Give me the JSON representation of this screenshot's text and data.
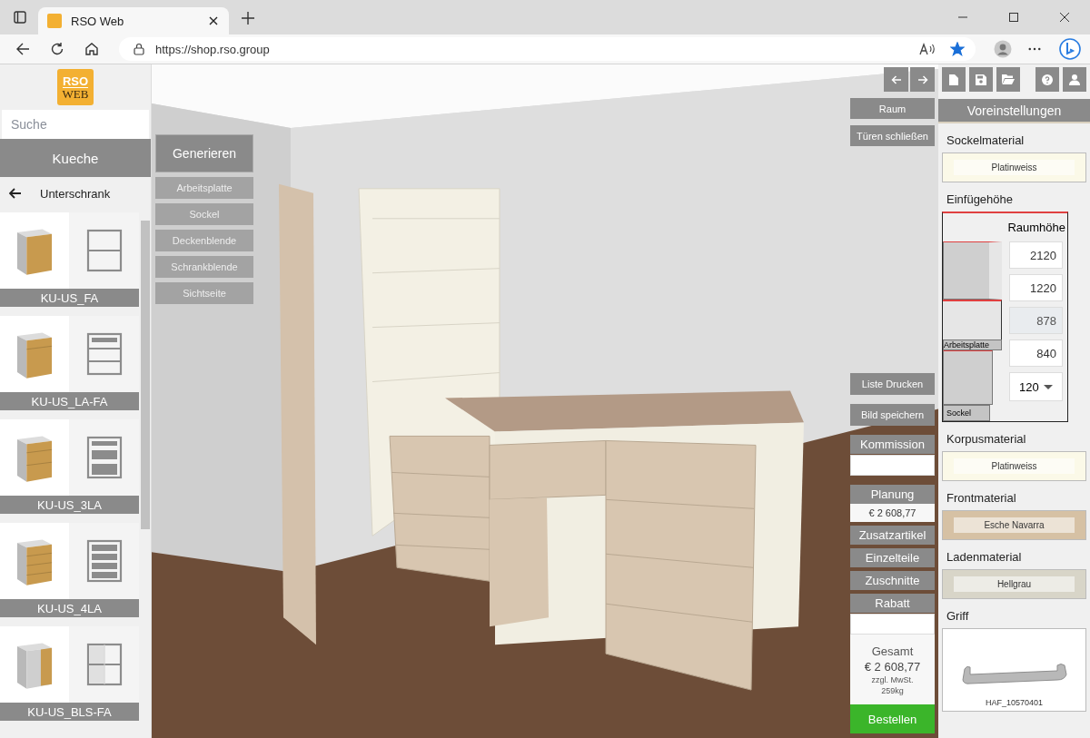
{
  "browser": {
    "tab_title": "RSO Web",
    "url": "https://shop.rso.group",
    "favorite": true
  },
  "sidebar": {
    "logo": {
      "top": "RSO",
      "bottom": "WEB"
    },
    "search": {
      "placeholder": "Suche"
    },
    "category": "Kueche",
    "breadcrumb": "Unterschrank",
    "items": [
      {
        "label": "KU-US_FA",
        "kind": "door"
      },
      {
        "label": "KU-US_LA-FA",
        "kind": "drawer-door"
      },
      {
        "label": "KU-US_3LA",
        "kind": "drawers-3"
      },
      {
        "label": "KU-US_4LA",
        "kind": "drawers-4"
      },
      {
        "label": "KU-US_BLS-FA",
        "kind": "corner"
      }
    ]
  },
  "scene": {
    "generate": {
      "title": "Generieren",
      "options": [
        "Arbeitsplatte",
        "Sockel",
        "Deckenblende",
        "Schrankblende",
        "Sichtseite"
      ]
    },
    "view_buttons": [
      "Raum",
      "Türen schließen"
    ],
    "action_buttons": [
      "Liste Drucken",
      "Bild speichern"
    ],
    "commission": {
      "label": "Kommission"
    },
    "planning": {
      "label": "Planung",
      "value": "€ 2 608,77"
    },
    "menu_buttons": [
      "Zusatzartikel",
      "Einzelteile",
      "Zuschnitte"
    ],
    "discount": {
      "label": "Rabatt"
    },
    "total": {
      "label": "Gesamt",
      "value": "€ 2 608,77",
      "note": "zzgl. MwSt.",
      "weight": "259kg"
    },
    "order_button": "Bestellen"
  },
  "presets": {
    "title": "Voreinstellungen",
    "base_material": {
      "label": "Sockelmaterial",
      "value": "Platinweiss",
      "color": "#fbf9e8"
    },
    "insert_height": {
      "label": "Einfügehöhe",
      "room_height_label": "Raumhöhe",
      "worktop_label": "Arbeitsplatte",
      "base_label": "Sockel",
      "fields": [
        {
          "value": "2120",
          "kind": "input",
          "disabled": false
        },
        {
          "value": "1220",
          "kind": "input",
          "disabled": false
        },
        {
          "value": "878",
          "kind": "input",
          "disabled": true
        },
        {
          "value": "840",
          "kind": "input",
          "disabled": false
        },
        {
          "value": "120",
          "kind": "select",
          "disabled": false
        }
      ]
    },
    "materials": [
      {
        "label": "Korpusmaterial",
        "value": "Platinweiss",
        "color": "#fbf9e8"
      },
      {
        "label": "Frontmaterial",
        "value": "Esche Navarra",
        "color": "#d6c1a4"
      },
      {
        "label": "Ladenmaterial",
        "value": "Hellgrau",
        "color": "#d8d5c8"
      }
    ],
    "handle": {
      "label": "Griff",
      "name": "HAF_10570401"
    }
  }
}
